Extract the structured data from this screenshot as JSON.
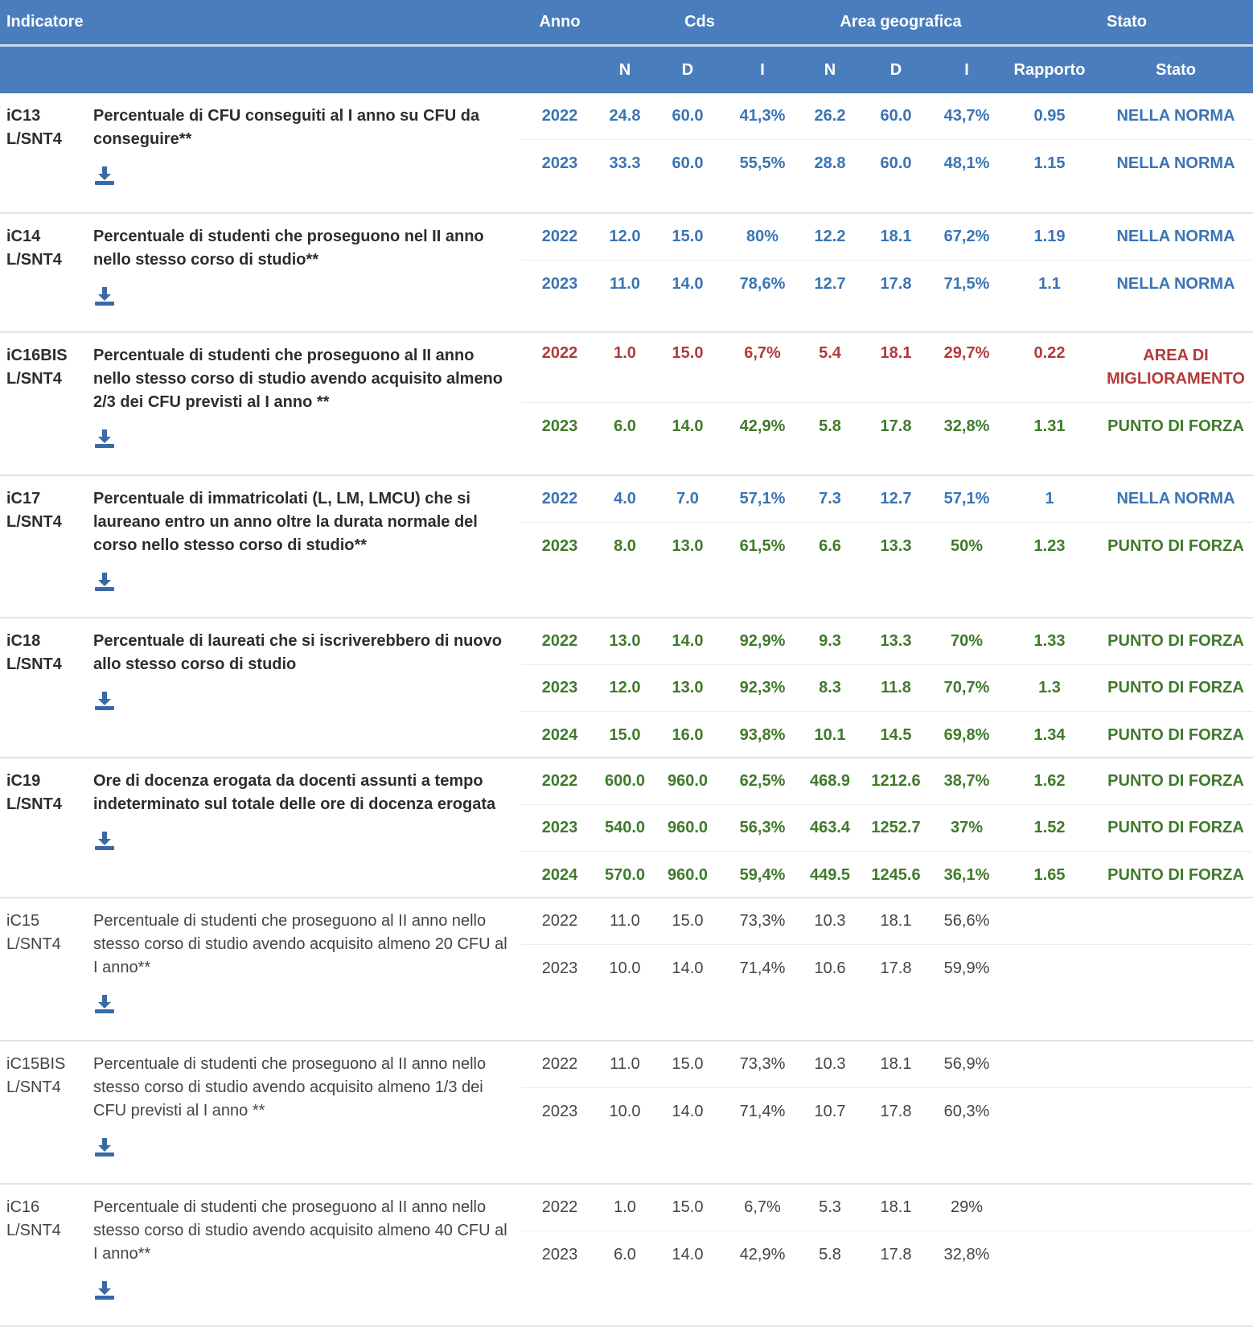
{
  "header": {
    "indicatore": "Indicatore",
    "anno": "Anno",
    "cds": "Cds",
    "area": "Area geografica",
    "stato": "Stato",
    "sub": {
      "n1": "N",
      "d1": "D",
      "i1": "I",
      "n2": "N",
      "d2": "D",
      "i2": "I",
      "rapporto": "Rapporto",
      "stato": "Stato"
    }
  },
  "colors": {
    "header_bg": "#4a7dbd",
    "nella_norma": "#3a74b4",
    "area_miglioramento": "#b23a3a",
    "punto_forza": "#3f7a2b"
  },
  "download_icon": "download-icon",
  "indicators": [
    {
      "code": "iC13 L/SNT4",
      "desc": "Percentuale di CFU conseguiti al I anno su CFU da conseguire**",
      "bold": true,
      "height": 150,
      "rows": [
        {
          "anno": "2022",
          "n1": "24.8",
          "d1": "60.0",
          "i1": "41,3%",
          "n2": "26.2",
          "d2": "60.0",
          "i2": "43,7%",
          "rap": "0.95",
          "stato": "NELLA NORMA",
          "color": "blue"
        },
        {
          "anno": "2023",
          "n1": "33.3",
          "d1": "60.0",
          "i1": "55,5%",
          "n2": "28.8",
          "d2": "60.0",
          "i2": "48,1%",
          "rap": "1.15",
          "stato": "NELLA NORMA",
          "color": "blue"
        }
      ]
    },
    {
      "code": "iC14 L/SNT4",
      "desc": "Percentuale di studenti che proseguono nel II anno nello stesso corso di studio**",
      "bold": true,
      "height": 148,
      "rows": [
        {
          "anno": "2022",
          "n1": "12.0",
          "d1": "15.0",
          "i1": "80%",
          "n2": "12.2",
          "d2": "18.1",
          "i2": "67,2%",
          "rap": "1.19",
          "stato": "NELLA NORMA",
          "color": "blue"
        },
        {
          "anno": "2023",
          "n1": "11.0",
          "d1": "14.0",
          "i1": "78,6%",
          "n2": "12.7",
          "d2": "17.8",
          "i2": "71,5%",
          "rap": "1.1",
          "stato": "NELLA NORMA",
          "color": "blue"
        }
      ]
    },
    {
      "code": "iC16BIS L/SNT4",
      "desc": "Percentuale di studenti che proseguono al II anno nello stesso corso di studio avendo acquisito almeno 2/3 dei CFU previsti al I anno **",
      "bold": true,
      "height": 178,
      "rows": [
        {
          "anno": "2022",
          "n1": "1.0",
          "d1": "15.0",
          "i1": "6,7%",
          "n2": "5.4",
          "d2": "18.1",
          "i2": "29,7%",
          "rap": "0.22",
          "stato": "AREA DI MIGLIORAMENTO",
          "color": "red",
          "tall": true
        },
        {
          "anno": "2023",
          "n1": "6.0",
          "d1": "14.0",
          "i1": "42,9%",
          "n2": "5.8",
          "d2": "17.8",
          "i2": "32,8%",
          "rap": "1.31",
          "stato": "PUNTO DI FORZA",
          "color": "green"
        }
      ]
    },
    {
      "code": "iC17 L/SNT4",
      "desc": "Percentuale di immatricolati (L, LM, LMCU) che si laureano entro un anno oltre la durata normale del corso nello stesso corso di studio**",
      "bold": true,
      "height": 177,
      "rows": [
        {
          "anno": "2022",
          "n1": "4.0",
          "d1": "7.0",
          "i1": "57,1%",
          "n2": "7.3",
          "d2": "12.7",
          "i2": "57,1%",
          "rap": "1",
          "stato": "NELLA NORMA",
          "color": "blue"
        },
        {
          "anno": "2023",
          "n1": "8.0",
          "d1": "13.0",
          "i1": "61,5%",
          "n2": "6.6",
          "d2": "13.3",
          "i2": "50%",
          "rap": "1.23",
          "stato": "PUNTO DI FORZA",
          "color": "green"
        }
      ]
    },
    {
      "code": "iC18 L/SNT4",
      "desc": "Percentuale di laureati che si iscriverebbero di nuovo allo stesso corso di studio",
      "bold": true,
      "height": 174,
      "rows": [
        {
          "anno": "2022",
          "n1": "13.0",
          "d1": "14.0",
          "i1": "92,9%",
          "n2": "9.3",
          "d2": "13.3",
          "i2": "70%",
          "rap": "1.33",
          "stato": "PUNTO DI FORZA",
          "color": "green"
        },
        {
          "anno": "2023",
          "n1": "12.0",
          "d1": "13.0",
          "i1": "92,3%",
          "n2": "8.3",
          "d2": "11.8",
          "i2": "70,7%",
          "rap": "1.3",
          "stato": "PUNTO DI FORZA",
          "color": "green"
        },
        {
          "anno": "2024",
          "n1": "15.0",
          "d1": "16.0",
          "i1": "93,8%",
          "n2": "10.1",
          "d2": "14.5",
          "i2": "69,8%",
          "rap": "1.34",
          "stato": "PUNTO DI FORZA",
          "color": "green"
        }
      ]
    },
    {
      "code": "iC19 L/SNT4",
      "desc": "Ore di docenza erogata da docenti assunti a tempo indeterminato sul totale delle ore di docenza erogata",
      "bold": true,
      "height": 174,
      "rows": [
        {
          "anno": "2022",
          "n1": "600.0",
          "d1": "960.0",
          "i1": "62,5%",
          "n2": "468.9",
          "d2": "1212.6",
          "i2": "38,7%",
          "rap": "1.62",
          "stato": "PUNTO DI FORZA",
          "color": "green"
        },
        {
          "anno": "2023",
          "n1": "540.0",
          "d1": "960.0",
          "i1": "56,3%",
          "n2": "463.4",
          "d2": "1252.7",
          "i2": "37%",
          "rap": "1.52",
          "stato": "PUNTO DI FORZA",
          "color": "green"
        },
        {
          "anno": "2024",
          "n1": "570.0",
          "d1": "960.0",
          "i1": "59,4%",
          "n2": "449.5",
          "d2": "1245.6",
          "i2": "36,1%",
          "rap": "1.65",
          "stato": "PUNTO DI FORZA",
          "color": "green"
        }
      ]
    },
    {
      "code": "iC15 L/SNT4",
      "desc": "Percentuale di studenti che proseguono al II anno nello stesso corso di studio avendo acquisito almeno 20 CFU al I anno**",
      "bold": false,
      "height": 178,
      "rows": [
        {
          "anno": "2022",
          "n1": "11.0",
          "d1": "15.0",
          "i1": "73,3%",
          "n2": "10.3",
          "d2": "18.1",
          "i2": "56,6%",
          "rap": "",
          "stato": "",
          "color": "grey"
        },
        {
          "anno": "2023",
          "n1": "10.0",
          "d1": "14.0",
          "i1": "71,4%",
          "n2": "10.6",
          "d2": "17.8",
          "i2": "59,9%",
          "rap": "",
          "stato": "",
          "color": "grey"
        }
      ]
    },
    {
      "code": "iC15BIS L/SNT4",
      "desc": "Percentuale di studenti che proseguono al II anno nello stesso corso di studio avendo acquisito almeno 1/3 dei CFU previsti al I anno **",
      "bold": false,
      "height": 178,
      "rows": [
        {
          "anno": "2022",
          "n1": "11.0",
          "d1": "15.0",
          "i1": "73,3%",
          "n2": "10.3",
          "d2": "18.1",
          "i2": "56,9%",
          "rap": "",
          "stato": "",
          "color": "grey"
        },
        {
          "anno": "2023",
          "n1": "10.0",
          "d1": "14.0",
          "i1": "71,4%",
          "n2": "10.7",
          "d2": "17.8",
          "i2": "60,3%",
          "rap": "",
          "stato": "",
          "color": "grey"
        }
      ]
    },
    {
      "code": "iC16 L/SNT4",
      "desc": "Percentuale di studenti che proseguono al II anno nello stesso corso di studio avendo acquisito almeno 40 CFU al I anno**",
      "bold": false,
      "height": 177,
      "rows": [
        {
          "anno": "2022",
          "n1": "1.0",
          "d1": "15.0",
          "i1": "6,7%",
          "n2": "5.3",
          "d2": "18.1",
          "i2": "29%",
          "rap": "",
          "stato": "",
          "color": "grey"
        },
        {
          "anno": "2023",
          "n1": "6.0",
          "d1": "14.0",
          "i1": "42,9%",
          "n2": "5.8",
          "d2": "17.8",
          "i2": "32,8%",
          "rap": "",
          "stato": "",
          "color": "grey"
        }
      ]
    }
  ]
}
